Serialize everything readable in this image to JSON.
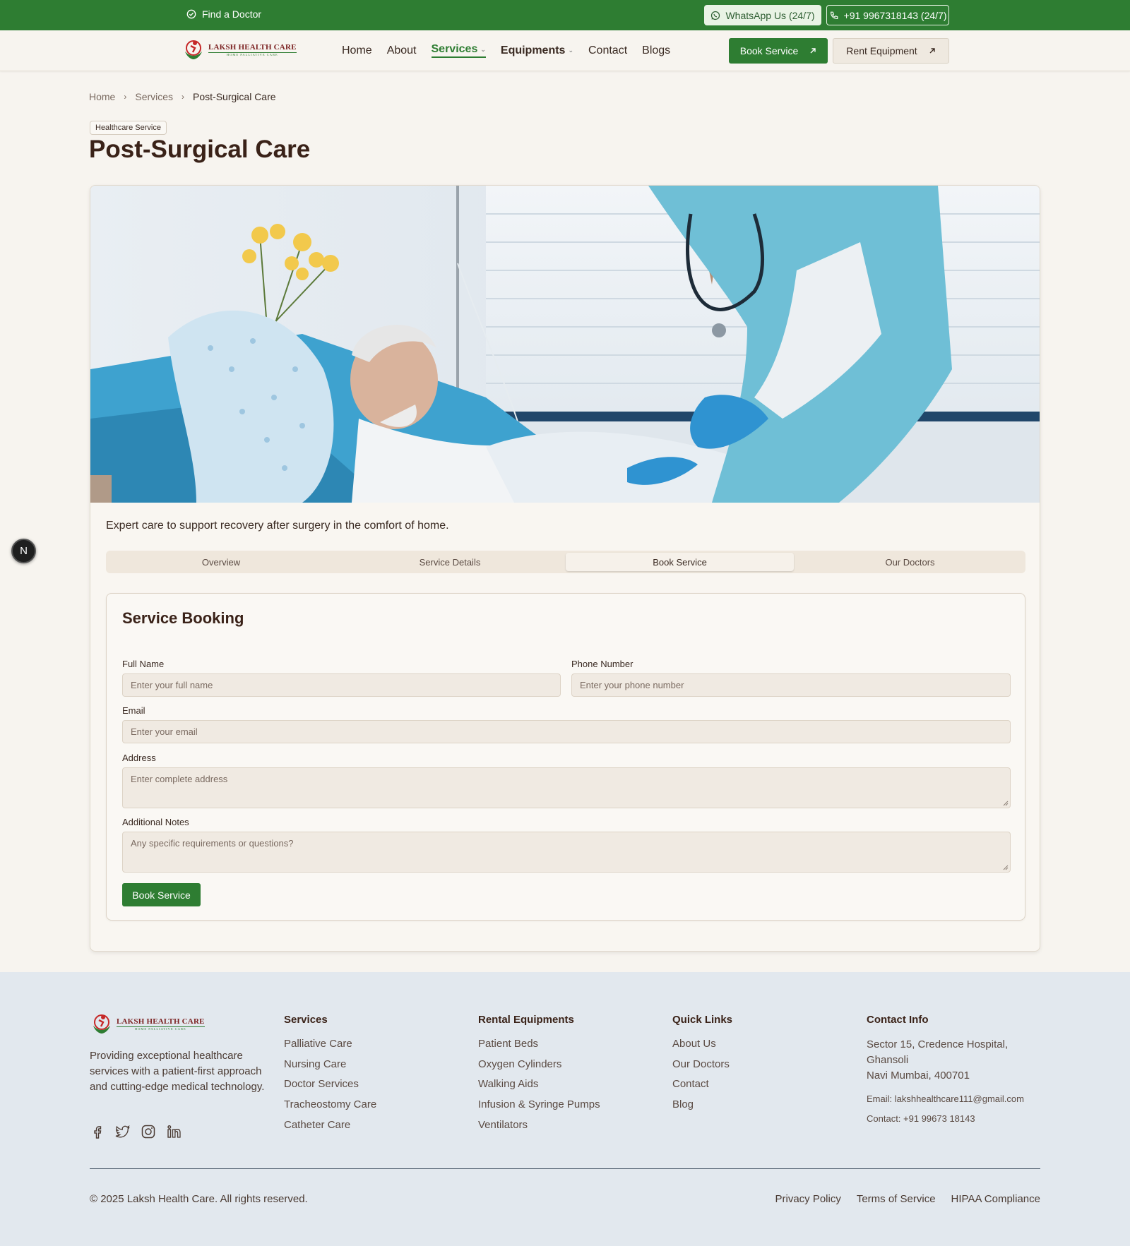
{
  "topbar": {
    "find_doctor": "Find a Doctor",
    "whatsapp": "WhatsApp Us (24/7)",
    "phone": "+91 9967318143 (24/7)"
  },
  "brand": {
    "name": "LAKSH HEALTH CARE",
    "tagline": "HOME PALLIATIVE CARE"
  },
  "nav": {
    "items": [
      "Home",
      "About",
      "Services",
      "Equipments",
      "Contact",
      "Blogs"
    ],
    "active": "Services",
    "book_service": "Book Service",
    "rent_equipment": "Rent Equipment"
  },
  "breadcrumb": [
    "Home",
    "Services",
    "Post-Surgical Care"
  ],
  "tag": "Healthcare Service",
  "title": "Post-Surgical Care",
  "intro": "Expert care to support recovery after surgery in the comfort of home.",
  "tabs": [
    "Overview",
    "Service Details",
    "Book Service",
    "Our Doctors"
  ],
  "active_tab": "Book Service",
  "form": {
    "title": "Service Booking",
    "full_name": {
      "label": "Full Name",
      "placeholder": "Enter your full name"
    },
    "phone": {
      "label": "Phone Number",
      "placeholder": "Enter your phone number"
    },
    "email": {
      "label": "Email",
      "placeholder": "Enter your email"
    },
    "address": {
      "label": "Address",
      "placeholder": "Enter complete address"
    },
    "notes": {
      "label": "Additional Notes",
      "placeholder": "Any specific requirements or questions?"
    },
    "submit": "Book Service"
  },
  "floating_badge": "N",
  "footer": {
    "description": "Providing exceptional healthcare services with a patient-first approach and cutting-edge medical technology.",
    "social_icons": [
      "facebook-icon",
      "twitter-icon",
      "instagram-icon",
      "linkedin-icon"
    ],
    "services": {
      "title": "Services",
      "items": [
        "Palliative Care",
        "Nursing Care",
        "Doctor Services",
        "Tracheostomy Care",
        "Catheter Care"
      ]
    },
    "rental": {
      "title": "Rental Equipments",
      "items": [
        "Patient Beds",
        "Oxygen Cylinders",
        "Walking Aids",
        "Infusion & Syringe Pumps",
        "Ventilators"
      ]
    },
    "quick_links": {
      "title": "Quick Links",
      "items": [
        "About Us",
        "Our Doctors",
        "Contact",
        "Blog"
      ]
    },
    "contact": {
      "title": "Contact Info",
      "address_line1": "Sector 15, Credence Hospital, Ghansoli",
      "address_line2": "Navi Mumbai, 400701",
      "email": "Email: lakshhealthcare111@gmail.com",
      "phone": "Contact: +91 99673 18143"
    },
    "copyright": "© 2025 Laksh Health Care. All rights reserved.",
    "legal": [
      "Privacy Policy",
      "Terms of Service",
      "HIPAA Compliance"
    ]
  },
  "colors": {
    "brand_green": "#2e7d32",
    "page_bg": "#f7f4ef",
    "footer_bg": "#e2e8ee",
    "heading_brown": "#3a2218"
  }
}
